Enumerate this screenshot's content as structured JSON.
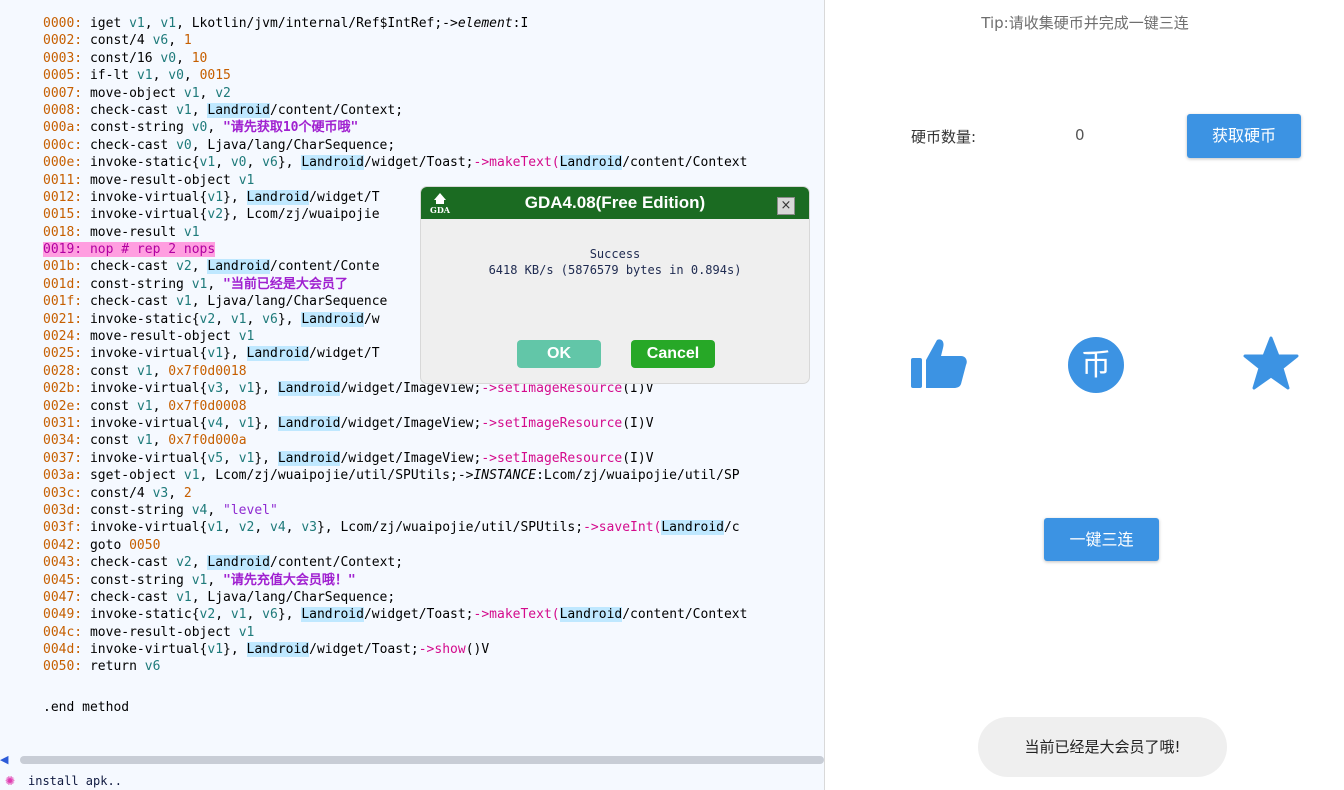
{
  "code": {
    "lines": [
      [
        [
          "0000: ",
          "off"
        ],
        [
          "iget ",
          ""
        ],
        [
          "v1",
          "reg"
        ],
        [
          ", ",
          ""
        ],
        [
          "v1",
          "reg"
        ],
        [
          ", Lkotlin/jvm/internal/Ref$IntRef;->",
          ""
        ],
        [
          "element",
          "ital"
        ],
        [
          ":I",
          ""
        ]
      ],
      [
        [
          "0002: ",
          "off"
        ],
        [
          "const/4 ",
          ""
        ],
        [
          "v6",
          "reg"
        ],
        [
          ", ",
          ""
        ],
        [
          "1",
          "num"
        ]
      ],
      [
        [
          "0003: ",
          "off"
        ],
        [
          "const/16 ",
          ""
        ],
        [
          "v0",
          "reg"
        ],
        [
          ", ",
          ""
        ],
        [
          "10",
          "num"
        ]
      ],
      [
        [
          "0005: ",
          "off"
        ],
        [
          "if-lt ",
          ""
        ],
        [
          "v1",
          "reg"
        ],
        [
          ", ",
          ""
        ],
        [
          "v0",
          "reg"
        ],
        [
          ", ",
          ""
        ],
        [
          "0015",
          "num"
        ]
      ],
      [
        [
          "0007: ",
          "off"
        ],
        [
          "move-object ",
          ""
        ],
        [
          "v1",
          "reg"
        ],
        [
          ", ",
          ""
        ],
        [
          "v2",
          "reg"
        ]
      ],
      [
        [
          "0008: ",
          "off"
        ],
        [
          "check-cast ",
          ""
        ],
        [
          "v1",
          "reg"
        ],
        [
          ", ",
          ""
        ],
        [
          "Landroid",
          "cls"
        ],
        [
          "/content/Context;",
          ""
        ]
      ],
      [
        [
          "000a: ",
          "off"
        ],
        [
          "const-string ",
          ""
        ],
        [
          "v0",
          "reg"
        ],
        [
          ", ",
          ""
        ],
        [
          "\"请先获取10个硬币哦\"",
          "strbold"
        ]
      ],
      [
        [
          "000c: ",
          "off"
        ],
        [
          "check-cast ",
          ""
        ],
        [
          "v0",
          "reg"
        ],
        [
          ", Ljava/lang/CharSequence;",
          ""
        ]
      ],
      [
        [
          "000e: ",
          "off"
        ],
        [
          "invoke-static{",
          ""
        ],
        [
          "v1",
          "reg"
        ],
        [
          ", ",
          ""
        ],
        [
          "v0",
          "reg"
        ],
        [
          ", ",
          ""
        ],
        [
          "v6",
          "reg"
        ],
        [
          "}, ",
          ""
        ],
        [
          "Landroid",
          "cls"
        ],
        [
          "/widget/Toast;",
          ""
        ],
        [
          "->makeText(",
          "mth"
        ],
        [
          "Landroid",
          "cls"
        ],
        [
          "/content/Context",
          ""
        ]
      ],
      [
        [
          "0011: ",
          "off"
        ],
        [
          "move-result-object ",
          ""
        ],
        [
          "v1",
          "reg"
        ]
      ],
      [
        [
          "0012: ",
          "off"
        ],
        [
          "invoke-virtual{",
          ""
        ],
        [
          "v1",
          "reg"
        ],
        [
          "}, ",
          ""
        ],
        [
          "Landroid",
          "cls"
        ],
        [
          "/widget/T",
          ""
        ]
      ],
      [
        [
          "0015: ",
          "off"
        ],
        [
          "invoke-virtual{",
          ""
        ],
        [
          "v2",
          "reg"
        ],
        [
          "}, Lcom/zj/wuaipojie",
          ""
        ]
      ],
      [
        [
          "0018: ",
          "off"
        ],
        [
          "move-result ",
          ""
        ],
        [
          "v1",
          "reg"
        ]
      ],
      [
        [
          "0019: nop # rep 2 nops",
          "hl"
        ]
      ],
      [
        [
          "001b: ",
          "off"
        ],
        [
          "check-cast ",
          ""
        ],
        [
          "v2",
          "reg"
        ],
        [
          ", ",
          ""
        ],
        [
          "Landroid",
          "cls"
        ],
        [
          "/content/Conte",
          ""
        ]
      ],
      [
        [
          "001d: ",
          "off"
        ],
        [
          "const-string ",
          ""
        ],
        [
          "v1",
          "reg"
        ],
        [
          ", ",
          ""
        ],
        [
          "\"当前已经是大会员了",
          "strbold"
        ]
      ],
      [
        [
          "001f: ",
          "off"
        ],
        [
          "check-cast ",
          ""
        ],
        [
          "v1",
          "reg"
        ],
        [
          ", Ljava/lang/CharSequence",
          ""
        ]
      ],
      [
        [
          "0021: ",
          "off"
        ],
        [
          "invoke-static{",
          ""
        ],
        [
          "v2",
          "reg"
        ],
        [
          ", ",
          ""
        ],
        [
          "v1",
          "reg"
        ],
        [
          ", ",
          ""
        ],
        [
          "v6",
          "reg"
        ],
        [
          "}, ",
          ""
        ],
        [
          "Landroid",
          "cls"
        ],
        [
          "/w",
          ""
        ]
      ],
      [
        [
          "0024: ",
          "off"
        ],
        [
          "move-result-object ",
          ""
        ],
        [
          "v1",
          "reg"
        ]
      ],
      [
        [
          "0025: ",
          "off"
        ],
        [
          "invoke-virtual{",
          ""
        ],
        [
          "v1",
          "reg"
        ],
        [
          "}, ",
          ""
        ],
        [
          "Landroid",
          "cls"
        ],
        [
          "/widget/T",
          ""
        ]
      ],
      [
        [
          "0028: ",
          "off"
        ],
        [
          "const ",
          ""
        ],
        [
          "v1",
          "reg"
        ],
        [
          ", ",
          ""
        ],
        [
          "0x7f0d0018",
          "num"
        ]
      ],
      [
        [
          "002b: ",
          "off"
        ],
        [
          "invoke-virtual{",
          ""
        ],
        [
          "v3",
          "reg"
        ],
        [
          ", ",
          ""
        ],
        [
          "v1",
          "reg"
        ],
        [
          "}, ",
          ""
        ],
        [
          "Landroid",
          "cls"
        ],
        [
          "/widget/ImageView;",
          ""
        ],
        [
          "->setImageResource",
          "mth"
        ],
        [
          "(I)V",
          ""
        ]
      ],
      [
        [
          "002e: ",
          "off"
        ],
        [
          "const ",
          ""
        ],
        [
          "v1",
          "reg"
        ],
        [
          ", ",
          ""
        ],
        [
          "0x7f0d0008",
          "num"
        ]
      ],
      [
        [
          "0031: ",
          "off"
        ],
        [
          "invoke-virtual{",
          ""
        ],
        [
          "v4",
          "reg"
        ],
        [
          ", ",
          ""
        ],
        [
          "v1",
          "reg"
        ],
        [
          "}, ",
          ""
        ],
        [
          "Landroid",
          "cls"
        ],
        [
          "/widget/ImageView;",
          ""
        ],
        [
          "->setImageResource",
          "mth"
        ],
        [
          "(I)V",
          ""
        ]
      ],
      [
        [
          "0034: ",
          "off"
        ],
        [
          "const ",
          ""
        ],
        [
          "v1",
          "reg"
        ],
        [
          ", ",
          ""
        ],
        [
          "0x7f0d000a",
          "num"
        ]
      ],
      [
        [
          "0037: ",
          "off"
        ],
        [
          "invoke-virtual{",
          ""
        ],
        [
          "v5",
          "reg"
        ],
        [
          ", ",
          ""
        ],
        [
          "v1",
          "reg"
        ],
        [
          "}, ",
          ""
        ],
        [
          "Landroid",
          "cls"
        ],
        [
          "/widget/ImageView;",
          ""
        ],
        [
          "->setImageResource",
          "mth"
        ],
        [
          "(I)V",
          ""
        ]
      ],
      [
        [
          "003a: ",
          "off"
        ],
        [
          "sget-object ",
          ""
        ],
        [
          "v1",
          "reg"
        ],
        [
          ", Lcom/zj/wuaipojie/util/SPUtils;->",
          ""
        ],
        [
          "INSTANCE",
          "ital"
        ],
        [
          ":Lcom/zj/wuaipojie/util/SP",
          ""
        ]
      ],
      [
        [
          "003c: ",
          "off"
        ],
        [
          "const/4 ",
          ""
        ],
        [
          "v3",
          "reg"
        ],
        [
          ", ",
          ""
        ],
        [
          "2",
          "num"
        ]
      ],
      [
        [
          "003d: ",
          "off"
        ],
        [
          "const-string ",
          ""
        ],
        [
          "v4",
          "reg"
        ],
        [
          ", ",
          ""
        ],
        [
          "\"level\"",
          "str"
        ]
      ],
      [
        [
          "003f: ",
          "off"
        ],
        [
          "invoke-virtual{",
          ""
        ],
        [
          "v1",
          "reg"
        ],
        [
          ", ",
          ""
        ],
        [
          "v2",
          "reg"
        ],
        [
          ", ",
          ""
        ],
        [
          "v4",
          "reg"
        ],
        [
          ", ",
          ""
        ],
        [
          "v3",
          "reg"
        ],
        [
          "}, Lcom/zj/wuaipojie/util/SPUtils;",
          ""
        ],
        [
          "->saveInt(",
          "mth"
        ],
        [
          "Landroid",
          "cls"
        ],
        [
          "/c",
          ""
        ]
      ],
      [
        [
          "0042: ",
          "off"
        ],
        [
          "goto ",
          ""
        ],
        [
          "0050",
          "num"
        ]
      ],
      [
        [
          "0043: ",
          "off"
        ],
        [
          "check-cast ",
          ""
        ],
        [
          "v2",
          "reg"
        ],
        [
          ", ",
          ""
        ],
        [
          "Landroid",
          "cls"
        ],
        [
          "/content/Context;",
          ""
        ]
      ],
      [
        [
          "0045: ",
          "off"
        ],
        [
          "const-string ",
          ""
        ],
        [
          "v1",
          "reg"
        ],
        [
          ", ",
          ""
        ],
        [
          "\"请先充值大会员哦！\"",
          "strbold"
        ]
      ],
      [
        [
          "0047: ",
          "off"
        ],
        [
          "check-cast ",
          ""
        ],
        [
          "v1",
          "reg"
        ],
        [
          ", Ljava/lang/CharSequence;",
          ""
        ]
      ],
      [
        [
          "0049: ",
          "off"
        ],
        [
          "invoke-static{",
          ""
        ],
        [
          "v2",
          "reg"
        ],
        [
          ", ",
          ""
        ],
        [
          "v1",
          "reg"
        ],
        [
          ", ",
          ""
        ],
        [
          "v6",
          "reg"
        ],
        [
          "}, ",
          ""
        ],
        [
          "Landroid",
          "cls"
        ],
        [
          "/widget/Toast;",
          ""
        ],
        [
          "->makeText(",
          "mth"
        ],
        [
          "Landroid",
          "cls"
        ],
        [
          "/content/Context",
          ""
        ]
      ],
      [
        [
          "004c: ",
          "off"
        ],
        [
          "move-result-object ",
          ""
        ],
        [
          "v1",
          "reg"
        ]
      ],
      [
        [
          "004d: ",
          "off"
        ],
        [
          "invoke-virtual{",
          ""
        ],
        [
          "v1",
          "reg"
        ],
        [
          "}, ",
          ""
        ],
        [
          "Landroid",
          "cls"
        ],
        [
          "/widget/Toast;",
          ""
        ],
        [
          "->show",
          "mth"
        ],
        [
          "()V",
          ""
        ]
      ],
      [
        [
          "0050: ",
          "off"
        ],
        [
          "return ",
          ""
        ],
        [
          "v6",
          "reg"
        ]
      ]
    ],
    "end_method": ".end method",
    "status_text": "install apk.."
  },
  "dialog": {
    "title": "GDA4.08(Free Edition)",
    "logo_text": "GDA",
    "message_line1": "Success",
    "message_line2": "6418 KB/s (5876579 bytes in 0.894s)",
    "ok_label": "OK",
    "cancel_label": "Cancel",
    "close_glyph": "×",
    "title_bar_color": "#1b6b22"
  },
  "app": {
    "tip": "Tip:请收集硬币并完成一键三连",
    "coin_label": "硬币数量:",
    "coin_count": "0",
    "get_coin_label": "获取硬币",
    "triple_label": "一键三连",
    "toast": "当前已经是大会员了哦!",
    "accent_color": "#3c93e3",
    "icons": [
      "thumbs-up-icon",
      "coin-icon",
      "star-icon"
    ],
    "coin_glyph": "币"
  }
}
